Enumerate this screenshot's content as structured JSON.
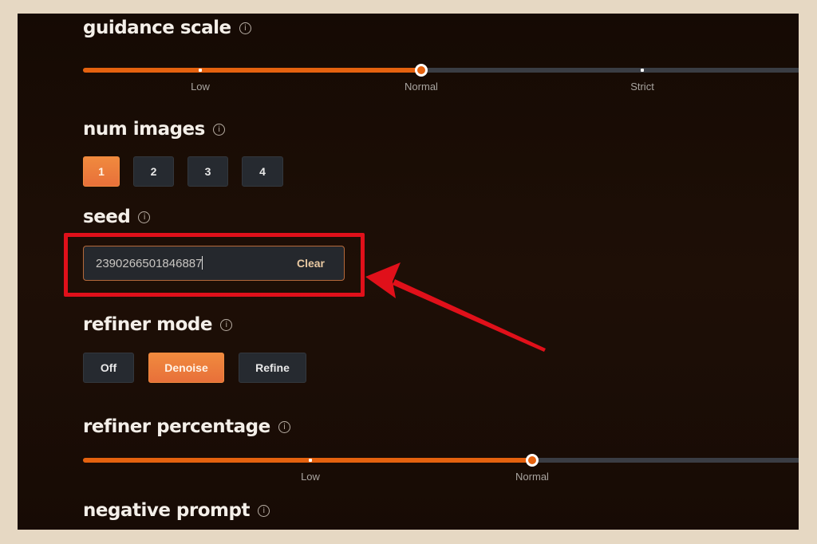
{
  "guidance_scale": {
    "label": "guidance scale",
    "ticks": [
      "Low",
      "Normal",
      "Strict"
    ],
    "selected": "Normal"
  },
  "num_images": {
    "label": "num images",
    "options": [
      "1",
      "2",
      "3",
      "4"
    ],
    "selected": "1"
  },
  "seed": {
    "label": "seed",
    "value": "2390266501846887",
    "clear_label": "Clear"
  },
  "refiner_mode": {
    "label": "refiner mode",
    "options": [
      "Off",
      "Denoise",
      "Refine"
    ],
    "selected": "Denoise"
  },
  "refiner_percentage": {
    "label": "refiner percentage",
    "ticks": [
      "Low",
      "Normal"
    ],
    "selected": "Normal"
  },
  "negative_prompt": {
    "label": "negative prompt"
  },
  "colors": {
    "accent": "#e5620f",
    "highlight": "#e0101a",
    "frame": "#e6d8c3"
  }
}
